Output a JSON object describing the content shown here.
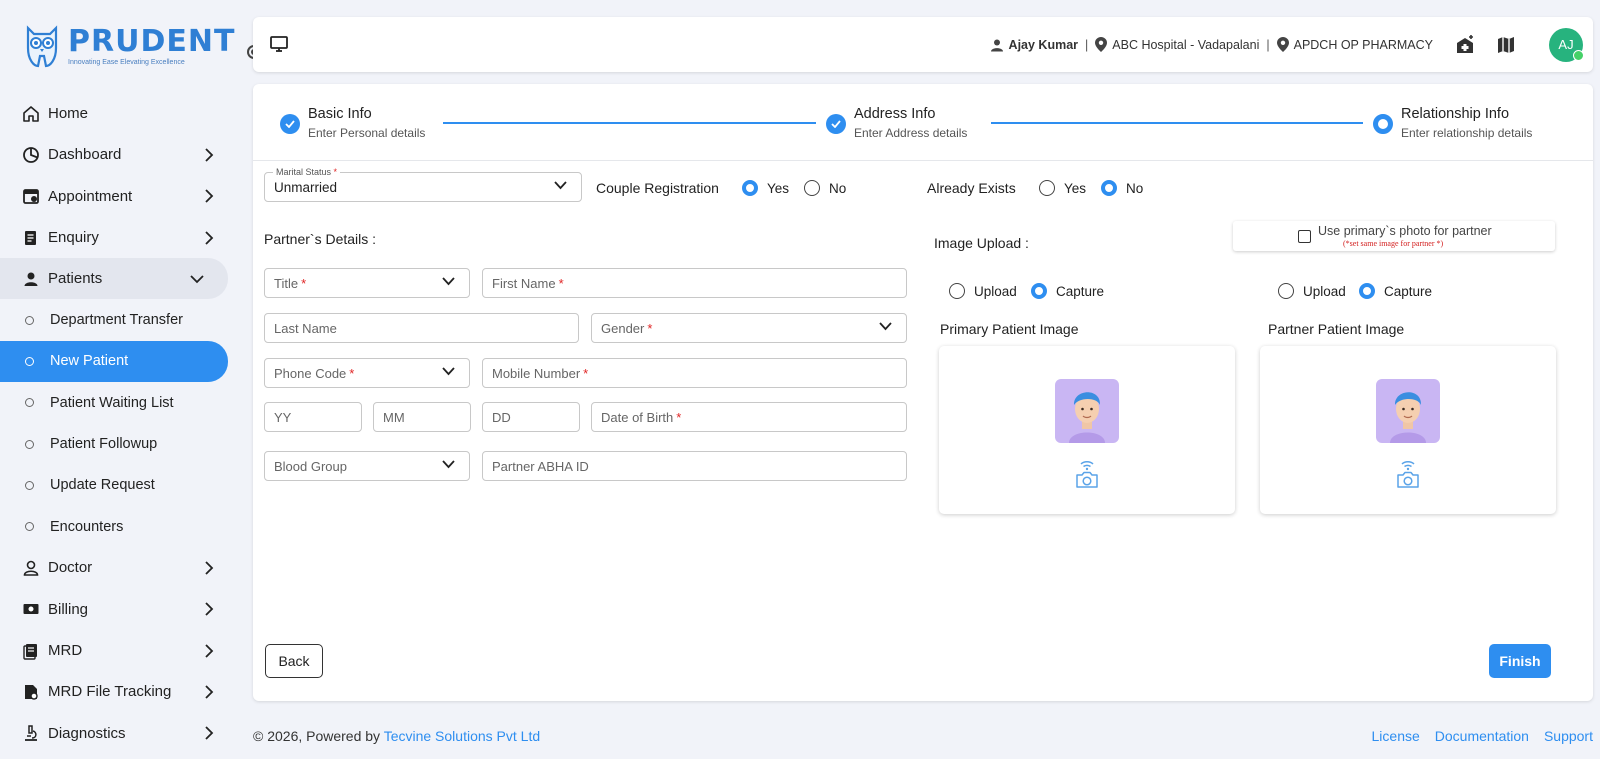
{
  "brand": {
    "name": "PRUDENT",
    "tagline": "Innovating Ease Elevating Excellence"
  },
  "sidebar": {
    "items": [
      {
        "label": "Home",
        "icon": "home-icon"
      },
      {
        "label": "Dashboard",
        "icon": "pie-chart-icon"
      },
      {
        "label": "Appointment",
        "icon": "calendar-icon"
      },
      {
        "label": "Enquiry",
        "icon": "document-icon"
      },
      {
        "label": "Patients",
        "icon": "user-icon"
      }
    ],
    "patients_sub": [
      {
        "label": "Department Transfer"
      },
      {
        "label": "New Patient"
      },
      {
        "label": "Patient Waiting List"
      },
      {
        "label": "Patient Followup"
      },
      {
        "label": "Update Request"
      },
      {
        "label": "Encounters"
      }
    ],
    "items_after": [
      {
        "label": "Doctor",
        "icon": "doctor-icon"
      },
      {
        "label": "Billing",
        "icon": "billing-icon"
      },
      {
        "label": "MRD",
        "icon": "records-icon"
      },
      {
        "label": "MRD File Tracking",
        "icon": "file-tracking-icon"
      },
      {
        "label": "Diagnostics",
        "icon": "microscope-icon"
      }
    ]
  },
  "header": {
    "user": "Ajay Kumar",
    "hospital": "ABC Hospital - Vadapalani",
    "pharmacy": "APDCH OP PHARMACY",
    "avatar_initials": "AJ",
    "separator": "|"
  },
  "stepper": {
    "steps": [
      {
        "title": "Basic Info",
        "sub": "Enter Personal details"
      },
      {
        "title": "Address Info",
        "sub": "Enter Address details"
      },
      {
        "title": "Relationship Info",
        "sub": "Enter relationship details"
      }
    ]
  },
  "form": {
    "marital_status_label": "Marital Status",
    "marital_status_value": "Unmarried",
    "couple_registration_label": "Couple Registration",
    "already_exists_label": "Already Exists",
    "yes": "Yes",
    "no": "No",
    "partner_details": "Partner`s Details :",
    "title": "Title",
    "first_name": "First Name",
    "last_name": "Last Name",
    "gender": "Gender",
    "phone_code": "Phone Code",
    "mobile_number": "Mobile Number",
    "yy": "YY",
    "mm": "MM",
    "dd": "DD",
    "dob": "Date of Birth",
    "blood_group": "Blood Group",
    "abha": "Partner ABHA ID",
    "required_mark": "*"
  },
  "image_section": {
    "label": "Image Upload :",
    "use_primary": "Use primary`s photo for partner",
    "use_primary_note": "(*set same image for partner *)",
    "upload": "Upload",
    "capture": "Capture",
    "primary_title": "Primary Patient Image",
    "partner_title": "Partner Patient Image"
  },
  "buttons": {
    "back": "Back",
    "finish": "Finish"
  },
  "footer": {
    "copyright": "© 2026, Powered by ",
    "company": "Tecvine Solutions Pvt Ltd",
    "links": [
      "License",
      "Documentation",
      "Support"
    ]
  },
  "colors": {
    "accent": "#2e8ef0",
    "brand": "#2f7fd4",
    "avatar": "#27b37e",
    "required": "#e02424"
  }
}
